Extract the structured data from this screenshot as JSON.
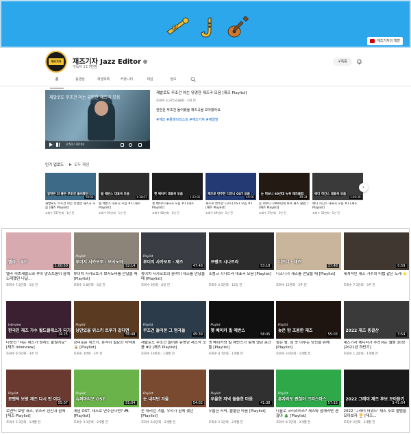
{
  "banner": {
    "link_label": "재즈기자의 책방",
    "icons": [
      "trumpet-icon",
      "saxophone-icon",
      "guitar-icon"
    ]
  },
  "channel": {
    "avatar_text": "재즈기자",
    "name": "재즈기자 Jazz Editor",
    "subscribers": "구독자 13.7만명",
    "subscribe_label": "구독중"
  },
  "tabs": [
    "홈",
    "동영상",
    "재생목록",
    "커뮤니티",
    "채널",
    "정보"
  ],
  "featured": {
    "overlay_title": "재발로도 무조건 아는 유명한 재즈곡 모음",
    "time": "3:50 / 30:01",
    "title": "재발로도 무조건 아는 유명한 재즈곡 모음 [재즈 Playlist]",
    "meta": "조회수 3,375,638회 · 1년 전",
    "desc": "한번은 무조건 들어봤을 재즈곡을 모아봤어요.",
    "hashtags": "#재즈 #플레이리스트 #재즈기자 #재일땅"
  },
  "popular": {
    "title": "인기 업로드",
    "play_all": "모두 재생",
    "videos": [
      {
        "cap": "알면은 더 좋은\n무조건 들어봤던",
        "dur": "59:02",
        "title": "재발로도 무조건 아는 유명한 재즈곡 모음 [재즈 Playlist]",
        "meta": "조회수 337만회 · 1년 전",
        "bg": "#3d6a86"
      },
      {
        "cap": "빌 에반스\n대표곡 모음",
        "dur": "1:38:07",
        "title": "빌 에반스 대표곡 모음 #1 [재즈 Playlist]",
        "meta": "조회수 91만회 · 1년 전",
        "bg": "#2e2e2e"
      },
      {
        "cap": "쳇 베이커\n대표곡 모음",
        "dur": "1:22:02",
        "title": "쳇 베이커 대표곡 모음 #1 [재즈 Playlist]",
        "meta": "조회수 80만회 · 1년 전",
        "bg": "#1f1f1f"
      },
      {
        "cap": "재즈로 연주한\n디즈니 OST 모음",
        "dur": "44:56",
        "title": "재즈로 연주한 디즈니 OST 모음 #1 [재즈 Playlist]",
        "meta": "조회수 49만회 · 1년 전",
        "bg": "#233a74"
      },
      {
        "cap": "눈 떠보니\n60년대 뉴욕 재즈클럽",
        "dur": "49:34",
        "title": "눈 떠보니 1960년대 뉴욕 재즈 클럽 ♪ [재즈 Playlist]",
        "meta": "조회수 37만회 · 1년 전",
        "bg": "#241a14"
      },
      {
        "cap": "에디 히긴스\n대표곡 모음",
        "dur": "1:20:39",
        "title": "에디 히긴스 대표곡 모음 #1 [재즈 Playlist]",
        "meta": "조회수 35만회 · 1년 전",
        "bg": "#3a3a3a"
      }
    ]
  },
  "grid": [
    {
      "cap": "멜라 · 루아",
      "pl": "",
      "dur": "1:00:50",
      "title": "멜라 피츠제럴드와 루이 암스트롱이 함께 노래했던 나날...",
      "meta": "조회수 7.2만회 · 1일 전",
      "bg": "#d7aab0"
    },
    {
      "cap": "루이지 사카모토 · 보사노바",
      "pl": "Playlist",
      "dur": "52:14",
      "title": "류이치 사카모토가 보사노바를 만났을 때 [Playlist]",
      "meta": "조회수 2.8만회 · 5일 전",
      "bg": "#8c8478"
    },
    {
      "cap": "루이지 사카모토 · 재즈",
      "pl": "Playlist",
      "dur": "47:48",
      "title": "류이치 사카모토의 음악이 재즈를 만났을 때 [Playlist]",
      "meta": "조회수 9만회 · 8일 전",
      "bg": "#3a3d44"
    },
    {
      "cap": "프랭크 시나트라",
      "pl": "",
      "dur": "53:18",
      "title": "프랭크 시나트라 대표곡 모음 [Playlist]",
      "meta": "조회수 2.5만회 · 12일 전",
      "bg": "#2b2b2b"
    },
    {
      "cap": "디즈니 · 재즈",
      "pl": "",
      "dur": "37:48",
      "title": "디즈니가 재즈를 만났을 때 [Playlist]",
      "meta": "조회수 12만회 · 3주 전",
      "bg": "#c8b59b"
    },
    {
      "cap": "",
      "pl": "",
      "dur": "0:59",
      "title": "세계적인 재즈 가수의 마법 같은 노래 ⭐",
      "meta": "조회수 7.3만회 · 3주 전",
      "bg": "#403830"
    },
    {
      "cap": "한국인 재즈 가수\n윌드클래스가 되기까지",
      "pl": "Interview",
      "dur": "14:25",
      "title": "나윤선 \"저는 재즈가 원치도 뭍뒀어요\" [재즈 Interview]",
      "meta": "조회수 6.5만회 · 3주 전",
      "bg": "#3a2030"
    },
    {
      "cap": "낭만있을 위스키\n트루가 같다면",
      "pl": "Playlist",
      "dur": "56:48",
      "title": "강미로운 위스키, 휴식이 필요한 저녁에 🥃 [Playlist]",
      "meta": "조회수 3만회 · 3주 전",
      "bg": "#5a3a20"
    },
    {
      "cap": "무조건 들어본\n그 명곡들",
      "pl": "Playlist",
      "dur": "45:39",
      "title": "재발로도 무조건 들어본 유명한 재즈곡 모음 #2 [재즈 Playlist]",
      "meta": "조회수 10만회 · 1개월 전",
      "bg": "#2b3b4a"
    },
    {
      "cap": "쳇 베이커\n빌 에반스",
      "pl": "Playlist",
      "dur": "58:05",
      "title": "쳇 베이커와 빌 에반스가 함께 했던 순간들 [Playlist]",
      "meta": "조회수 8.7만회 · 1개월 전",
      "bg": "#101010"
    },
    {
      "cap": "늦은 밤\n조용한 재즈",
      "pl": "Playlist",
      "dur": "55:03",
      "title": "늦은 밤, 잠 못 이루는 당신을 위해 [Playlist]",
      "meta": "조회수 3.6만회 · 1개월 전",
      "bg": "#1e1410"
    },
    {
      "cap": "2022 재즈 총결산",
      "pl": "",
      "dur": "3:54",
      "title": "재즈기자 에디터가 추천하는 앨범 10장 [2021년 하반기]",
      "meta": "조회수 1.2만회 · 1개월 전",
      "bg": "#3a3a3a"
    },
    {
      "cap": "로맨틱 보랑 재즈\n다시 안 이다",
      "pl": "Playlist",
      "dur": "55:07",
      "title": "로맨틱 보랑 재즈, 위스키 한잔과 함께 [재즈 Playlist]",
      "meta": "조회수 5.3만회 · 1개월 전",
      "bg": "#6a3a30"
    },
    {
      "cap": "슈퍼마리오 OST",
      "pl": "Playlist",
      "dur": "51:04",
      "title": "게임 OST, 재즈로 연주한다면? 🎮 [Playlist]",
      "meta": "조회수 3.1만회 · 2개월 전",
      "bg": "#6ab24a"
    },
    {
      "cap": "눈 내리던 겨울",
      "pl": "Playlist",
      "dur": "54:02",
      "title": "눈 내리던 겨울, 우리가 함께 했던 [Playlist]",
      "meta": "조회수 6.6만회 · 2개월 전",
      "bg": "#7a4a30"
    },
    {
      "cap": "우울한 저녁\n쓸쓸한 마음",
      "pl": "Playlist",
      "dur": "41:38",
      "title": "우울한 저녁, 쓸쓸한 마음 [Playlist]",
      "meta": "조회수 2.1만회 · 2개월 전",
      "bg": "#303030"
    },
    {
      "cap": "혼자라도 괜찮아\n크리스마스",
      "pl": "Playlist",
      "dur": "57:15",
      "title": "나홀로 크리스마스? 재즈와 함께라면 괜찮아 🎄 [Playlist]",
      "meta": "조회수 8.7만회 · 2개월 전",
      "bg": "#2fa84a"
    },
    {
      "cap": "2022 그래미\n재즈 후보 모아듣기",
      "pl": "",
      "dur": "3:41:04",
      "title": "2022 '그래미 어워드' 재즈 후보 앨범을 모아보자 🏆 [재즈...",
      "meta": "조회수 2만회 · 2개월 전",
      "bg": "#1a1a1a"
    }
  ]
}
